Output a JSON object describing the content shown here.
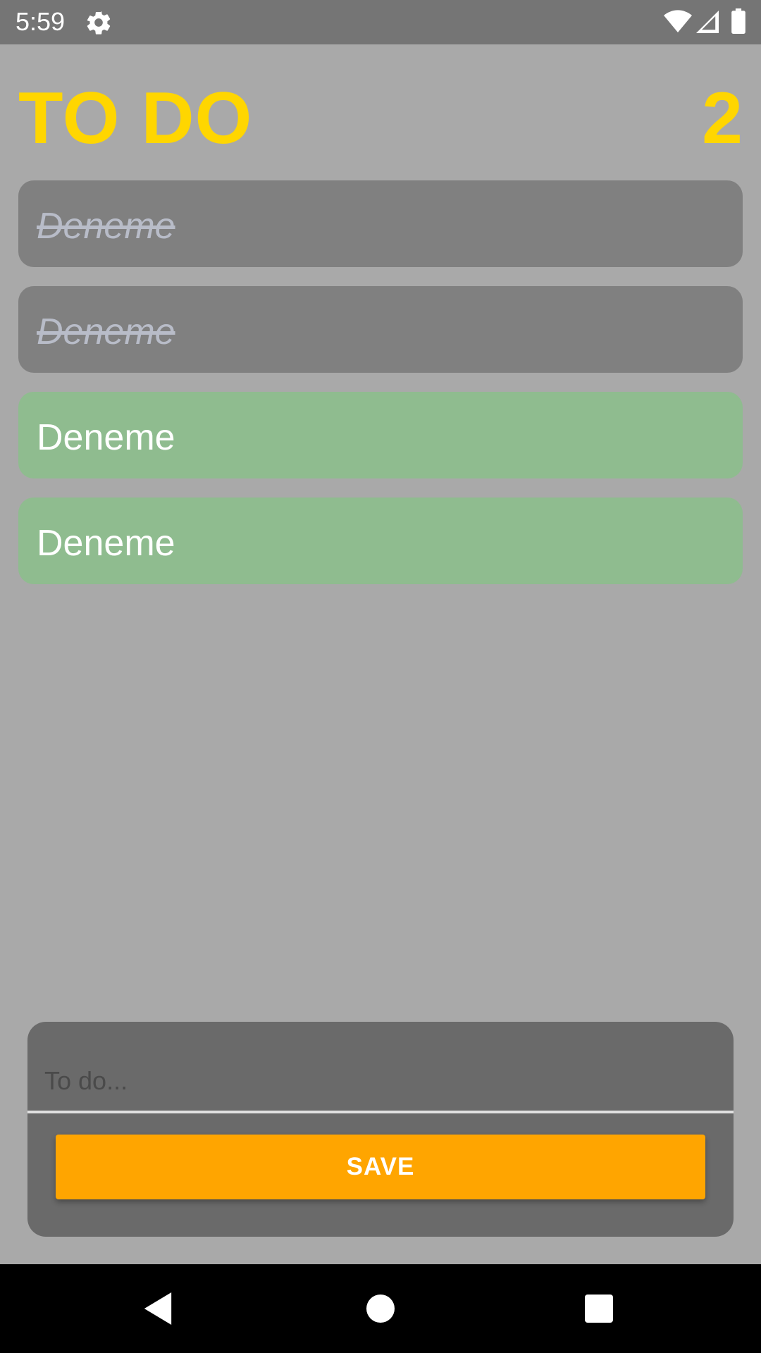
{
  "status_bar": {
    "time": "5:59",
    "icons": [
      "gear-icon",
      "wifi-icon",
      "signal-icon",
      "battery-icon"
    ]
  },
  "header": {
    "title": "TO DO",
    "count": "2"
  },
  "todos": [
    {
      "text": "Deneme",
      "state": "done"
    },
    {
      "text": "Deneme",
      "state": "done"
    },
    {
      "text": "Deneme",
      "state": "active"
    },
    {
      "text": "Deneme",
      "state": "active"
    }
  ],
  "input": {
    "placeholder": "To do...",
    "value": ""
  },
  "save_button": {
    "label": "SAVE"
  },
  "nav_bar": {
    "icons": [
      "back-icon",
      "home-icon",
      "recents-icon"
    ]
  },
  "colors": {
    "accent_title": "#ffd600",
    "done_item": "#808080",
    "active_item": "#8fbc8f",
    "save_button": "#ffa500",
    "background": "#a9a9a9"
  }
}
